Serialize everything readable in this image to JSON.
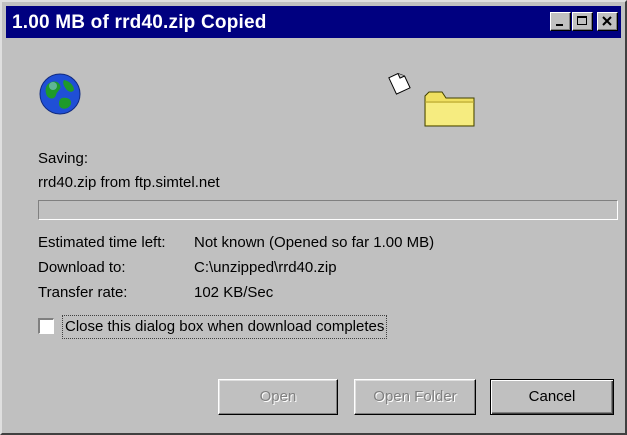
{
  "window": {
    "title": "1.00 MB of rrd40.zip Copied",
    "controls": {
      "minimize": "minimize",
      "maximize": "maximize",
      "close": "close"
    }
  },
  "icons": {
    "animation_left": "globe-icon",
    "animation_mid": "paper-icon",
    "animation_right": "folder-icon"
  },
  "status": {
    "saving_label": "Saving:",
    "saving_detail": "rrd40.zip from ftp.simtel.net"
  },
  "progress": {
    "fraction": 0.0
  },
  "details": {
    "time_left_label": "Estimated time left:",
    "time_left_value": "Not known (Opened so far 1.00 MB)",
    "download_to_label": "Download to:",
    "download_to_value": "C:\\unzipped\\rrd40.zip",
    "transfer_rate_label": "Transfer rate:",
    "transfer_rate_value": "102 KB/Sec"
  },
  "close_option": {
    "label": "Close this dialog box when download completes",
    "checked": false
  },
  "buttons": {
    "open": "Open",
    "open_folder": "Open Folder",
    "cancel": "Cancel"
  },
  "colors": {
    "titlebar": "#000080",
    "face": "#c0c0c0",
    "folder": "#f0e060"
  }
}
